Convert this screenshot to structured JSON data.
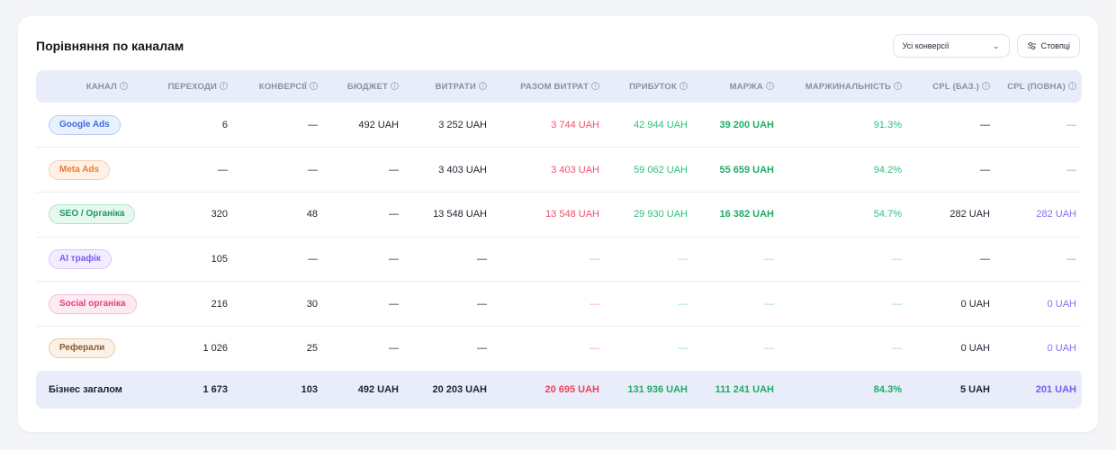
{
  "title": "Порівняння по каналам",
  "filter": {
    "selected": "Усі конверсії"
  },
  "columns_button": "Стовпці",
  "headers": [
    "КАНАЛ",
    "ПЕРЕХОДИ",
    "КОНВЕРСІЇ",
    "БЮДЖЕТ",
    "ВИТРАТИ",
    "РАЗОМ ВИТРАТ",
    "ПРИБУТОК",
    "МАРЖА",
    "МАРЖИНАЛЬНІСТЬ",
    "CPL (БАЗ.)",
    "CPL (ПОВНА)"
  ],
  "rows": [
    {
      "channel": "Google Ads",
      "chip": {
        "bg": "#e9f0fe",
        "border": "#b9cdf7",
        "color": "#3b6fe0"
      },
      "visits": "6",
      "conversions": "—",
      "budget": "492 UAH",
      "spend": "3 252 UAH",
      "total_spend": "3 744 UAH",
      "profit": "42 944 UAH",
      "margin": "39 200 UAH",
      "margin_pct": "91.3%",
      "cpl_base": "—",
      "cpl_full": "—"
    },
    {
      "channel": "Meta Ads",
      "chip": {
        "bg": "#fff0e6",
        "border": "#f8cfb1",
        "color": "#f07a2e"
      },
      "visits": "—",
      "conversions": "—",
      "budget": "—",
      "spend": "3 403 UAH",
      "total_spend": "3 403 UAH",
      "profit": "59 062 UAH",
      "margin": "55 659 UAH",
      "margin_pct": "94.2%",
      "cpl_base": "—",
      "cpl_full": "—"
    },
    {
      "channel": "SEO / Органіка",
      "chip": {
        "bg": "#e6f8ef",
        "border": "#ade5c7",
        "color": "#1a9a5e"
      },
      "visits": "320",
      "conversions": "48",
      "budget": "—",
      "spend": "13 548 UAH",
      "total_spend": "13 548 UAH",
      "profit": "29 930 UAH",
      "margin": "16 382 UAH",
      "margin_pct": "54.7%",
      "cpl_base": "282 UAH",
      "cpl_full": "282 UAH"
    },
    {
      "channel": "AI трафік",
      "chip": {
        "bg": "#f1ecfe",
        "border": "#d4c6fa",
        "color": "#7b5cf0"
      },
      "visits": "105",
      "conversions": "—",
      "budget": "—",
      "spend": "—",
      "total_spend": "—",
      "profit": "—",
      "margin": "—",
      "margin_pct": "—",
      "cpl_base": "—",
      "cpl_full": "—"
    },
    {
      "channel": "Social органіка",
      "chip": {
        "bg": "#fdebf3",
        "border": "#f5bcd5",
        "color": "#e0407f"
      },
      "visits": "216",
      "conversions": "30",
      "budget": "—",
      "spend": "—",
      "total_spend": "—",
      "profit": "—",
      "margin": "—",
      "margin_pct": "—",
      "cpl_base": "0 UAH",
      "cpl_full": "0 UAH"
    },
    {
      "channel": "Реферали",
      "chip": {
        "bg": "#fbf1e7",
        "border": "#e6c9a9",
        "color": "#8a5a2b"
      },
      "visits": "1 026",
      "conversions": "25",
      "budget": "—",
      "spend": "—",
      "total_spend": "—",
      "profit": "—",
      "margin": "—",
      "margin_pct": "—",
      "cpl_base": "0 UAH",
      "cpl_full": "0 UAH"
    }
  ],
  "total": {
    "label": "Бізнес загалом",
    "visits": "1 673",
    "conversions": "103",
    "budget": "492 UAH",
    "spend": "20 203 UAH",
    "total_spend": "20 695 UAH",
    "profit": "131 936 UAH",
    "margin": "111 241 UAH",
    "margin_pct": "84.3%",
    "cpl_base": "5 UAH",
    "cpl_full": "201 UAH"
  }
}
